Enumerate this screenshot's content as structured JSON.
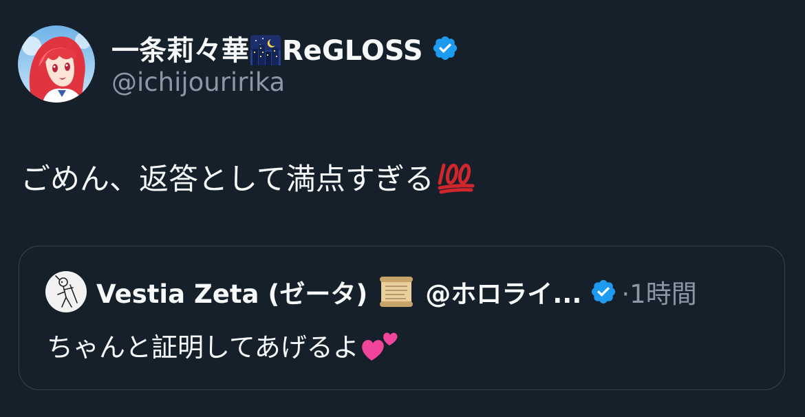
{
  "author": {
    "name_part1": "一条莉々華",
    "name_emoji": "night-city-emoji",
    "name_part2": "ReGLOSS",
    "handle": "@ichijouririka",
    "verified": true
  },
  "tweet": {
    "text": "ごめん、返答として満点すぎる",
    "emoji": "hundred-points-emoji"
  },
  "quoted_tweet": {
    "author_name": "Vestia Zeta (ゼータ)",
    "author_emoji": "scroll-emoji",
    "author_handle": "@ホロライ...",
    "verified": true,
    "separator": "·",
    "time": "1時間",
    "text": "ちゃんと証明してあげるよ",
    "emoji": "two-hearts-emoji"
  },
  "colors": {
    "background": "#15202b",
    "text_primary": "#f7f9f9",
    "text_secondary": "#8b98a5",
    "verified_blue": "#1d9bf0",
    "border": "#38444d"
  }
}
